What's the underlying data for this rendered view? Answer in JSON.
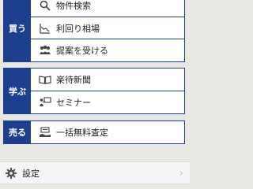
{
  "groups": [
    {
      "label": "買う",
      "items": [
        {
          "label": "物件検索",
          "icon": "search-icon"
        },
        {
          "label": "利回り相場",
          "icon": "chart-icon"
        },
        {
          "label": "提案を受ける",
          "icon": "people-icon"
        }
      ]
    },
    {
      "label": "学ぶ",
      "items": [
        {
          "label": "楽待新聞",
          "icon": "book-icon"
        },
        {
          "label": "セミナー",
          "icon": "presenter-icon"
        }
      ]
    },
    {
      "label": "売る",
      "items": [
        {
          "label": "一括無料査定",
          "icon": "assessment-icon"
        }
      ]
    }
  ],
  "settings": {
    "label": "設定",
    "icon": "gear-icon"
  },
  "colors": {
    "accent": "#1d3f8f",
    "background": "#e9e7e2"
  }
}
